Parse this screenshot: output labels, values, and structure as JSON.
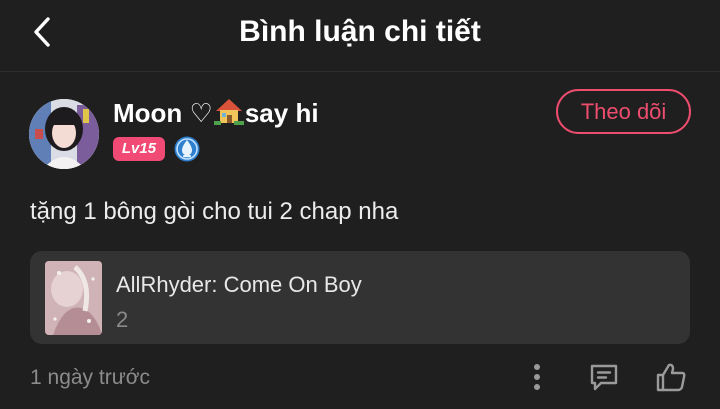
{
  "header": {
    "title": "Bình luận chi tiết",
    "back_icon": "chevron-left-icon"
  },
  "user": {
    "name_prefix": "Moon ♡",
    "name_suffix": "say hi",
    "name_emoji": "house-emoji-icon",
    "level": "Lv15",
    "level_color": "#f14a74",
    "rank_icon": "blue-rank-badge-icon",
    "follow_label": "Theo dõi",
    "follow_color": "#ee4d6e"
  },
  "comment": {
    "text": "tặng 1 bông gòi cho tui 2 chap nha",
    "time_ago": "1 ngày trước"
  },
  "story": {
    "title": "AllRhyder: Come On Boy",
    "chapter": "2"
  },
  "actions": {
    "more_icon": "more-vertical-icon",
    "reply_icon": "comment-icon",
    "like_icon": "thumbs-up-icon"
  }
}
